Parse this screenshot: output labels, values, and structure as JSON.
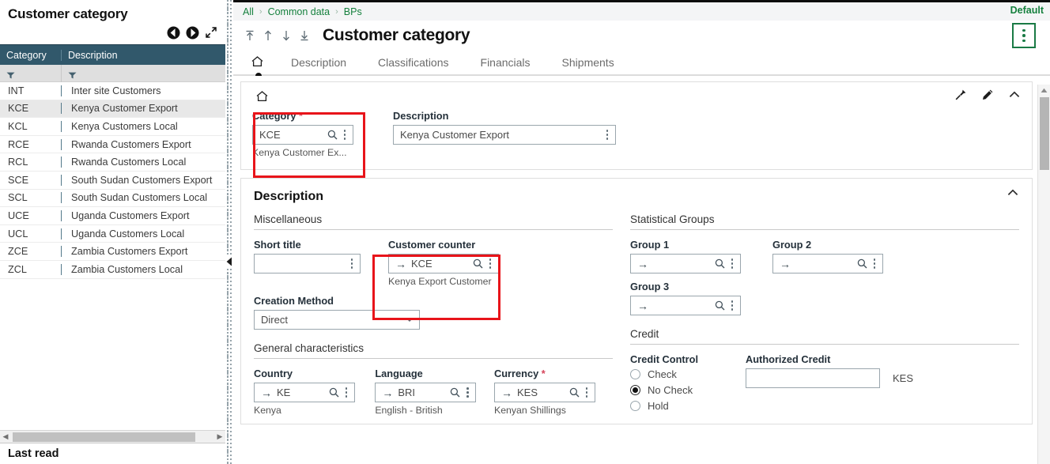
{
  "left_panel": {
    "title": "Customer category",
    "nav_prev_icon": "circle-left-icon",
    "nav_next_icon": "circle-right-icon",
    "expand_icon": "expand-diagonal-icon",
    "columns": [
      "Category",
      "Description"
    ],
    "filter_icon": "funnel-icon",
    "rows": [
      {
        "category": "INT",
        "description": "Inter site Customers",
        "selected": false
      },
      {
        "category": "KCE",
        "description": "Kenya Customer Export",
        "selected": true
      },
      {
        "category": "KCL",
        "description": "Kenya Customers Local",
        "selected": false
      },
      {
        "category": "RCE",
        "description": "Rwanda Customers Export",
        "selected": false
      },
      {
        "category": "RCL",
        "description": "Rwanda Customers Local",
        "selected": false
      },
      {
        "category": "SCE",
        "description": "South Sudan Customers Export",
        "selected": false
      },
      {
        "category": "SCL",
        "description": "South Sudan Customers Local",
        "selected": false
      },
      {
        "category": "UCE",
        "description": "Uganda Customers Export",
        "selected": false
      },
      {
        "category": "UCL",
        "description": "Uganda Customers Local",
        "selected": false
      },
      {
        "category": "ZCE",
        "description": "Zambia Customers Export",
        "selected": false
      },
      {
        "category": "ZCL",
        "description": "Zambia Customers Local",
        "selected": false
      }
    ],
    "footer_label": "Last read",
    "hscroll_left_icon": "scroll-left-arrow-icon",
    "hscroll_right_icon": "scroll-right-arrow-icon",
    "collapse_icon": "collapse-panel-left-icon"
  },
  "header": {
    "breadcrumb": [
      "All",
      "Common data",
      "BPs"
    ],
    "breadcrumb_separator": ">",
    "default_label": "Default",
    "page_title": "Customer category",
    "nav_first_icon": "nav-first-icon",
    "nav_prev_icon": "nav-prev-icon",
    "nav_next_icon": "nav-next-icon",
    "nav_last_icon": "nav-last-icon",
    "kebab_icon": "kebab-menu-icon",
    "accent_green": "#15803d"
  },
  "tabs": [
    {
      "label": "",
      "icon": "home-icon",
      "active": true
    },
    {
      "label": "Description",
      "active": false
    },
    {
      "label": "Classifications",
      "active": false
    },
    {
      "label": "Financials",
      "active": false
    },
    {
      "label": "Shipments",
      "active": false
    }
  ],
  "identity_card": {
    "home_icon": "home-icon",
    "pin_icon": "pin-icon",
    "edit_icon": "pencil-icon",
    "collapse_icon": "chevron-up-icon",
    "fields": [
      {
        "label": "Category",
        "required": true,
        "value": "KCE",
        "help": "Kenya Customer Ex...",
        "search_icon": "search-icon",
        "actions_icon": "kebab-menu-icon"
      },
      {
        "label": "Description",
        "required": false,
        "value": "Kenya Customer Export",
        "help": "",
        "actions_icon": "kebab-menu-icon"
      }
    ]
  },
  "description_section": {
    "title": "Description",
    "collapse_icon": "chevron-up-icon",
    "left": {
      "miscellaneous": {
        "subhead": "Miscellaneous",
        "short_title": {
          "label": "Short title",
          "value": "",
          "actions_icon": "kebab-menu-icon"
        },
        "customer_counter": {
          "label": "Customer counter",
          "value": "KCE",
          "help": "Kenya Export Customer",
          "link_icon": "arrow-right-icon",
          "search_icon": "search-icon",
          "actions_icon": "kebab-menu-icon"
        },
        "creation_method": {
          "label": "Creation Method",
          "value": "Direct",
          "caret_icon": "chevron-down-icon",
          "options": [
            "Direct"
          ]
        }
      },
      "general": {
        "subhead": "General characteristics",
        "fields": [
          {
            "label": "Country",
            "required": false,
            "value": "KE",
            "help": "Kenya",
            "link_icon": "arrow-right-icon",
            "search_icon": "search-icon",
            "actions_icon": "kebab-menu-icon"
          },
          {
            "label": "Language",
            "required": false,
            "value": "BRI",
            "help": "English - British",
            "link_icon": "arrow-right-icon",
            "search_icon": "search-icon",
            "actions_icon": "kebab-menu-icon"
          },
          {
            "label": "Currency",
            "required": true,
            "value": "KES",
            "help": "Kenyan Shillings",
            "link_icon": "arrow-right-icon",
            "search_icon": "search-icon",
            "actions_icon": "kebab-menu-icon"
          }
        ]
      }
    },
    "right": {
      "statistical_groups": {
        "subhead": "Statistical Groups",
        "fields": [
          {
            "label": "Group 1",
            "value": "",
            "link_icon": "arrow-right-icon",
            "search_icon": "search-icon",
            "actions_icon": "kebab-menu-icon"
          },
          {
            "label": "Group 2",
            "value": "",
            "link_icon": "arrow-right-icon",
            "search_icon": "search-icon",
            "actions_icon": "kebab-menu-icon"
          },
          {
            "label": "Group 3",
            "value": "",
            "link_icon": "arrow-right-icon",
            "search_icon": "search-icon",
            "actions_icon": "kebab-menu-icon"
          }
        ]
      },
      "credit": {
        "subhead": "Credit",
        "credit_control": {
          "label": "Credit Control",
          "options": [
            {
              "label": "Check",
              "selected": false
            },
            {
              "label": "No Check",
              "selected": true
            },
            {
              "label": "Hold",
              "selected": false
            }
          ]
        },
        "authorized_credit": {
          "label": "Authorized Credit",
          "value": "",
          "currency": "KES"
        }
      }
    }
  },
  "scrollbar": {
    "up_icon": "scroll-up-arrow-icon"
  },
  "highlight_color": "#e8141a"
}
